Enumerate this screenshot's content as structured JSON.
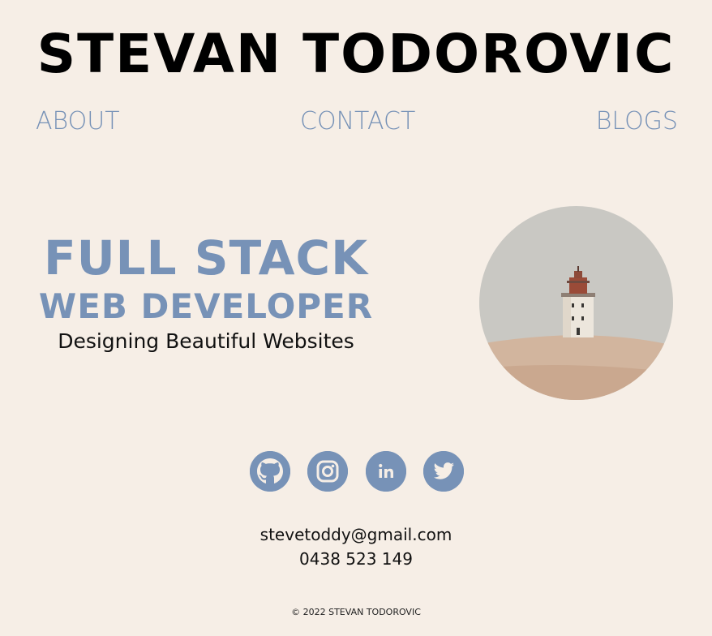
{
  "header": {
    "title": "STEVAN TODOROVIC"
  },
  "nav": {
    "items": [
      "ABOUT",
      "CONTACT",
      "BLOGS"
    ]
  },
  "hero": {
    "line1": "FULL STACK",
    "line2": "WEB DEVELOPER",
    "tagline": "Designing Beautiful Websites"
  },
  "socials": [
    "github-icon",
    "instagram-icon",
    "linkedin-icon",
    "twitter-icon"
  ],
  "contact": {
    "email": "stevetoddy@gmail.com",
    "phone": "0438 523 149"
  },
  "footer": {
    "text": "© 2022 STEVAN TODOROVIC"
  },
  "colors": {
    "background": "#f6eee6",
    "accent": "#7792b7",
    "text": "#111111"
  }
}
